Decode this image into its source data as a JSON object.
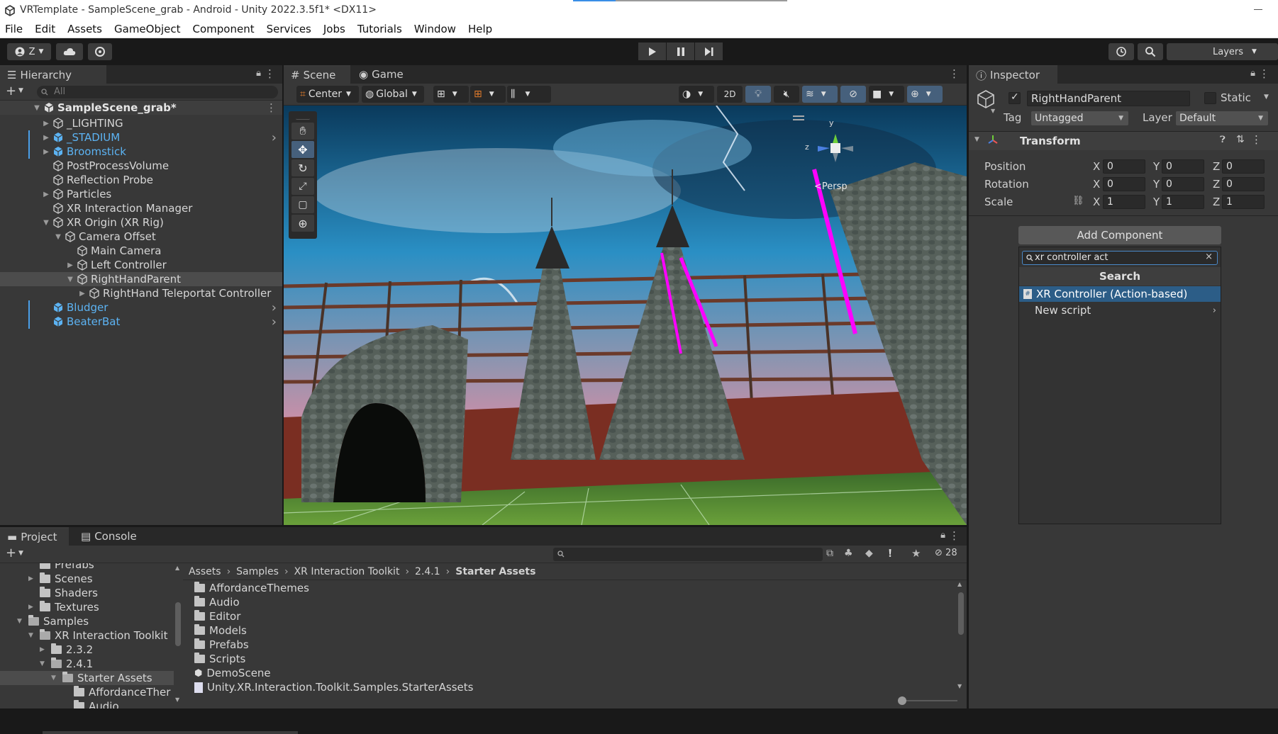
{
  "window": {
    "title": "VRTemplate - SampleScene_grab - Android - Unity 2022.3.5f1* <DX11>"
  },
  "menu": [
    "File",
    "Edit",
    "Assets",
    "GameObject",
    "Component",
    "Services",
    "Jobs",
    "Tutorials",
    "Window",
    "Help"
  ],
  "toolbar": {
    "account_label": "Z",
    "layers_label": "Layers"
  },
  "hierarchy": {
    "tab_label": "Hierarchy",
    "search_placeholder": "All",
    "scene_name": "SampleScene_grab*",
    "items": [
      {
        "label": "_LIGHTING"
      },
      {
        "label": "_STADIUM"
      },
      {
        "label": "Broomstick"
      },
      {
        "label": "PostProcessVolume"
      },
      {
        "label": "Reflection Probe"
      },
      {
        "label": "Particles"
      },
      {
        "label": "XR Interaction Manager"
      },
      {
        "label": "XR Origin (XR Rig)"
      },
      {
        "label": "Camera Offset"
      },
      {
        "label": "Main Camera"
      },
      {
        "label": "Left Controller"
      },
      {
        "label": "RightHandParent"
      },
      {
        "label": "RightHand Teleportat Controller"
      },
      {
        "label": "Bludger"
      },
      {
        "label": "BeaterBat"
      }
    ]
  },
  "scene": {
    "tab_scene": "Scene",
    "tab_game": "Game",
    "pivot_label": "Center",
    "space_label": "Global",
    "mode_2d": "2D",
    "persp_label": "<Persp",
    "gizmo_y": "y",
    "gizmo_z": "z"
  },
  "inspector": {
    "tab_label": "Inspector",
    "object_name": "RightHandParent",
    "static_label": "Static",
    "tag_label": "Tag",
    "tag_value": "Untagged",
    "layer_label": "Layer",
    "layer_value": "Default",
    "transform_title": "Transform",
    "position_label": "Position",
    "rotation_label": "Rotation",
    "scale_label": "Scale",
    "axis_x": "X",
    "axis_y": "Y",
    "axis_z": "Z",
    "position": {
      "x": "0",
      "y": "0",
      "z": "0"
    },
    "rotation": {
      "x": "0",
      "y": "0",
      "z": "0"
    },
    "scale": {
      "x": "1",
      "y": "1",
      "z": "1"
    },
    "add_component_label": "Add Component",
    "search_value": "xr controller act",
    "search_header": "Search",
    "results": [
      {
        "label": "XR Controller (Action-based)"
      },
      {
        "label": "New script"
      }
    ]
  },
  "project": {
    "tab_project": "Project",
    "tab_console": "Console",
    "hidden_count": "28",
    "tree": [
      {
        "label": "Prefabs"
      },
      {
        "label": "Scenes"
      },
      {
        "label": "Shaders"
      },
      {
        "label": "Textures"
      },
      {
        "label": "Samples"
      },
      {
        "label": "XR Interaction Toolkit"
      },
      {
        "label": "2.3.2"
      },
      {
        "label": "2.4.1"
      },
      {
        "label": "Starter Assets"
      },
      {
        "label": "AffordanceTher"
      },
      {
        "label": "Audio"
      }
    ],
    "breadcrumb": [
      "Assets",
      "Samples",
      "XR Interaction Toolkit",
      "2.4.1",
      "Starter Assets"
    ],
    "files": [
      {
        "label": "AffordanceThemes"
      },
      {
        "label": "Audio"
      },
      {
        "label": "Editor"
      },
      {
        "label": "Models"
      },
      {
        "label": "Prefabs"
      },
      {
        "label": "Scripts"
      },
      {
        "label": "DemoScene"
      },
      {
        "label": "Unity.XR.Interaction.Toolkit.Samples.StarterAssets"
      }
    ]
  },
  "colors": {
    "accent_blue": "#2c5d87",
    "prefab_blue": "#5cb3f3",
    "selection_magenta": "#ff00ff"
  }
}
